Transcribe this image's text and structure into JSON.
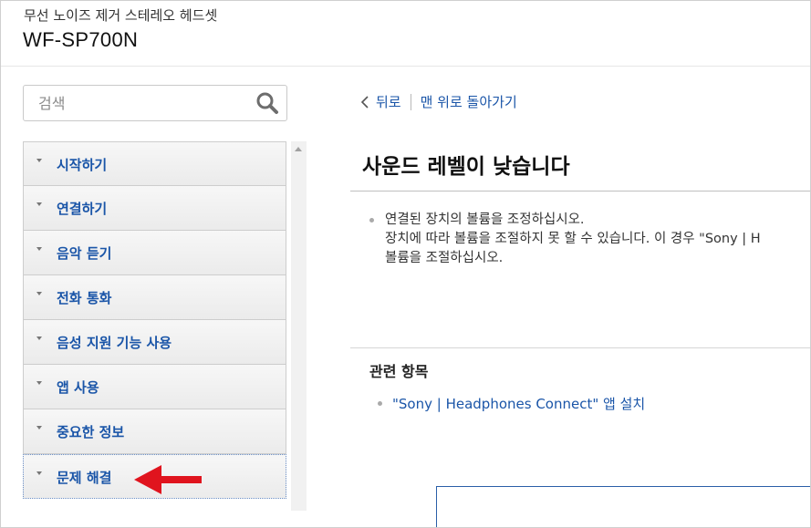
{
  "header": {
    "subtitle": "무선 노이즈 제거 스테레오 헤드셋",
    "product": "WF-SP700N"
  },
  "search": {
    "placeholder": "검색",
    "icon": "search-icon"
  },
  "nav": {
    "items": [
      {
        "label": "시작하기"
      },
      {
        "label": "연결하기"
      },
      {
        "label": "음악 듣기"
      },
      {
        "label": "전화 통화"
      },
      {
        "label": "음성 지원 기능 사용"
      },
      {
        "label": "앱 사용"
      },
      {
        "label": "중요한 정보"
      },
      {
        "label": "문제 해결"
      }
    ],
    "active_index": 7
  },
  "breadcrumb": {
    "back": "뒤로",
    "top": "맨 위로 돌아가기"
  },
  "content": {
    "title": "사운드 레벨이 낮습니다",
    "bullets": [
      {
        "lines": [
          "연결된 장치의 볼륨을 조정하십시오.",
          "장치에 따라 볼륨을 조절하지 못 할 수 있습니다. 이 경우 \"Sony | H",
          "볼륨을 조절하십시오."
        ]
      }
    ]
  },
  "related": {
    "title": "관련 항목",
    "items": [
      {
        "label": "\"Sony | Headphones Connect\" 앱 설치"
      }
    ]
  },
  "colors": {
    "link": "#1a55a8",
    "annotation_arrow": "#e0141e"
  }
}
